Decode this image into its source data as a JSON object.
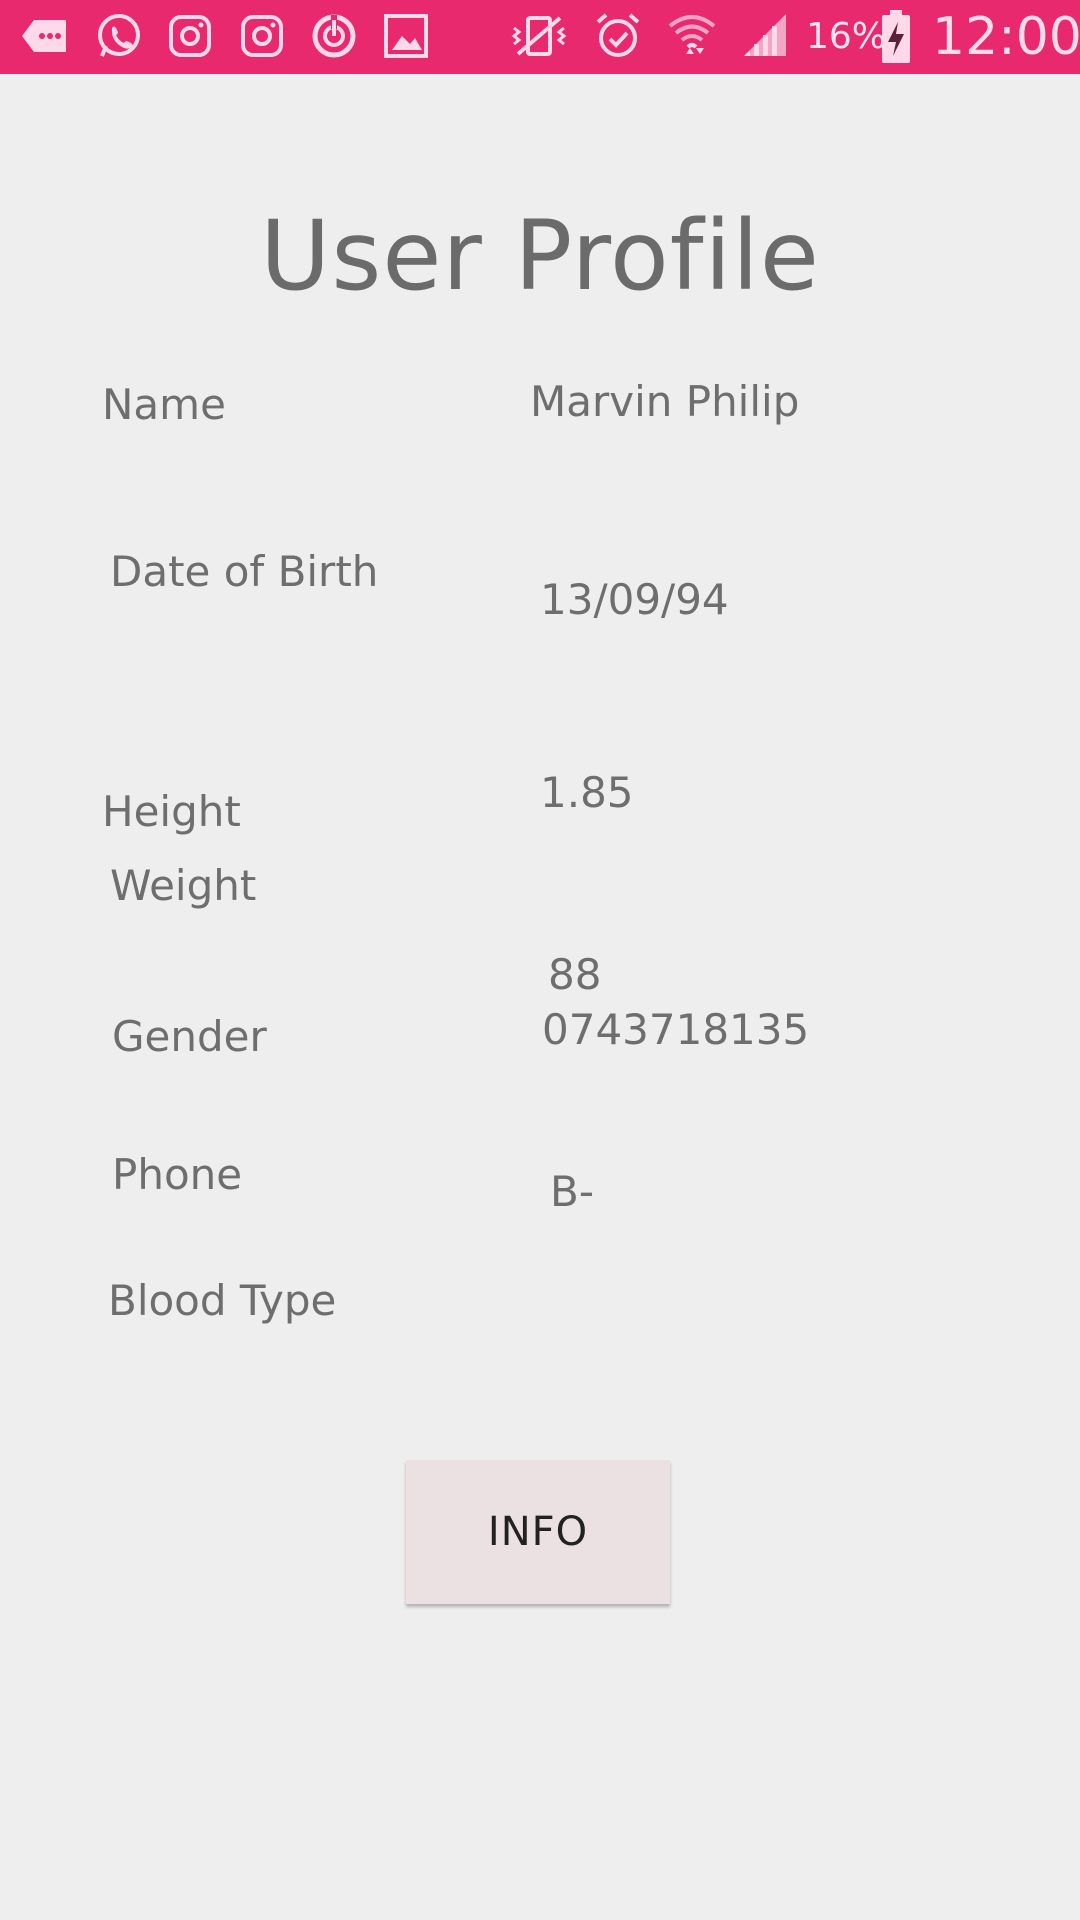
{
  "status_bar": {
    "battery_percent": "16%",
    "time": "12:00",
    "background_color": "#e8296e",
    "left_icons": [
      "message-icon",
      "whatsapp-icon",
      "instagram-icon",
      "instagram-icon",
      "sync-app-icon",
      "gallery-icon"
    ],
    "right_icons": [
      "vibrate-icon",
      "alarm-icon",
      "wifi-icon",
      "signal-icon",
      "battery-charging-icon"
    ]
  },
  "profile": {
    "title": "User Profile",
    "labels": {
      "name": "Name",
      "dob": "Date of Birth",
      "height": "Height",
      "weight": "Weight",
      "gender": "Gender",
      "phone": "Phone",
      "blood_type": "Blood Type"
    },
    "values": {
      "name": "Marvin Philip",
      "dob": "13/09/94",
      "height": "1.85",
      "weight": "88",
      "phone": "0743718135",
      "blood_type": "B-"
    }
  },
  "actions": {
    "info_label": "INFO"
  }
}
